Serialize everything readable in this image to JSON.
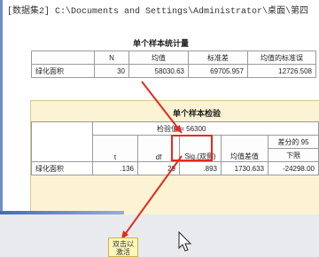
{
  "header": {
    "dataset_path": "[数据集2] C:\\Documents and Settings\\Administrator\\桌面\\第四"
  },
  "one_sample_statistics": {
    "title": "单个样本统计量",
    "columns": [
      "",
      "N",
      "均值",
      "标准差",
      "均值的标准误"
    ],
    "row": {
      "label": "绿化面积",
      "n": "30",
      "mean": "58030.63",
      "sd": "69705.957",
      "se": "12726.508"
    }
  },
  "one_sample_test": {
    "title": "单个样本检验",
    "test_value": "检验值 = 56300",
    "columns": {
      "t": "t",
      "df": "df",
      "sig": "Sig.(双侧)",
      "mean_diff": "均值差值",
      "ci_header": "差分的 95",
      "ci_lower": "下限"
    },
    "row": {
      "label": "绿化面积",
      "t": ".136",
      "df": "29",
      "sig": ".893",
      "mean_diff": "1730.633",
      "lower": "-24298.00"
    }
  },
  "tooltip": {
    "line1": "双击以",
    "line2": "激活"
  },
  "colors": {
    "annotation": "#e22a1e",
    "panel": "#fbf3d3",
    "tooltip": "#fff7b8"
  }
}
